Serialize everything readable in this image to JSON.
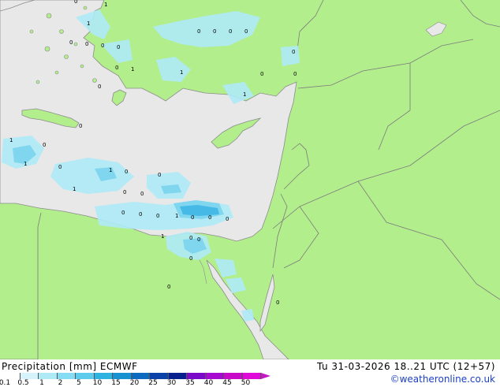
{
  "title": {
    "product": "Precipitation [mm]",
    "model": "ECMWF",
    "valid": "Tu 31-03-2026 18..21 UTC (12+57)"
  },
  "credit": "©weatheronline.co.uk",
  "colors": {
    "land": "#b2ee8c",
    "sea": "#e8e8e8",
    "border": "#7c7c7c",
    "coast": "#8c8c8c",
    "precip_light": "#aeeaf6",
    "precip_mid": "#7fd6ee",
    "precip_heavy": "#46b9e6"
  },
  "legend": {
    "ticks": [
      "0.1",
      "0.5",
      "1",
      "2",
      "5",
      "10",
      "15",
      "20",
      "25",
      "30",
      "35",
      "40",
      "45",
      "50"
    ],
    "colors": [
      "#ffffff",
      "#d6f3fb",
      "#aeeaf6",
      "#86dcf2",
      "#5ecaec",
      "#2eb2e0",
      "#1891d0",
      "#0a6bbf",
      "#0a42a8",
      "#06208e",
      "#7b0ac8",
      "#a60ad0",
      "#c80ac8",
      "#e00ad8"
    ]
  },
  "map_labels": [
    "0",
    "1",
    "1",
    "0",
    "0",
    "0",
    "0",
    "0",
    "0",
    "0",
    "0",
    "0",
    "0",
    "1",
    "0",
    "0",
    "1",
    "0",
    "1",
    "0",
    "0",
    "1",
    "1",
    "0",
    "1",
    "0",
    "0",
    "1",
    "0",
    "0",
    "0",
    "0",
    "1",
    "0",
    "0",
    "0",
    "0",
    "1",
    "0",
    "0",
    "0",
    "0",
    "0"
  ]
}
